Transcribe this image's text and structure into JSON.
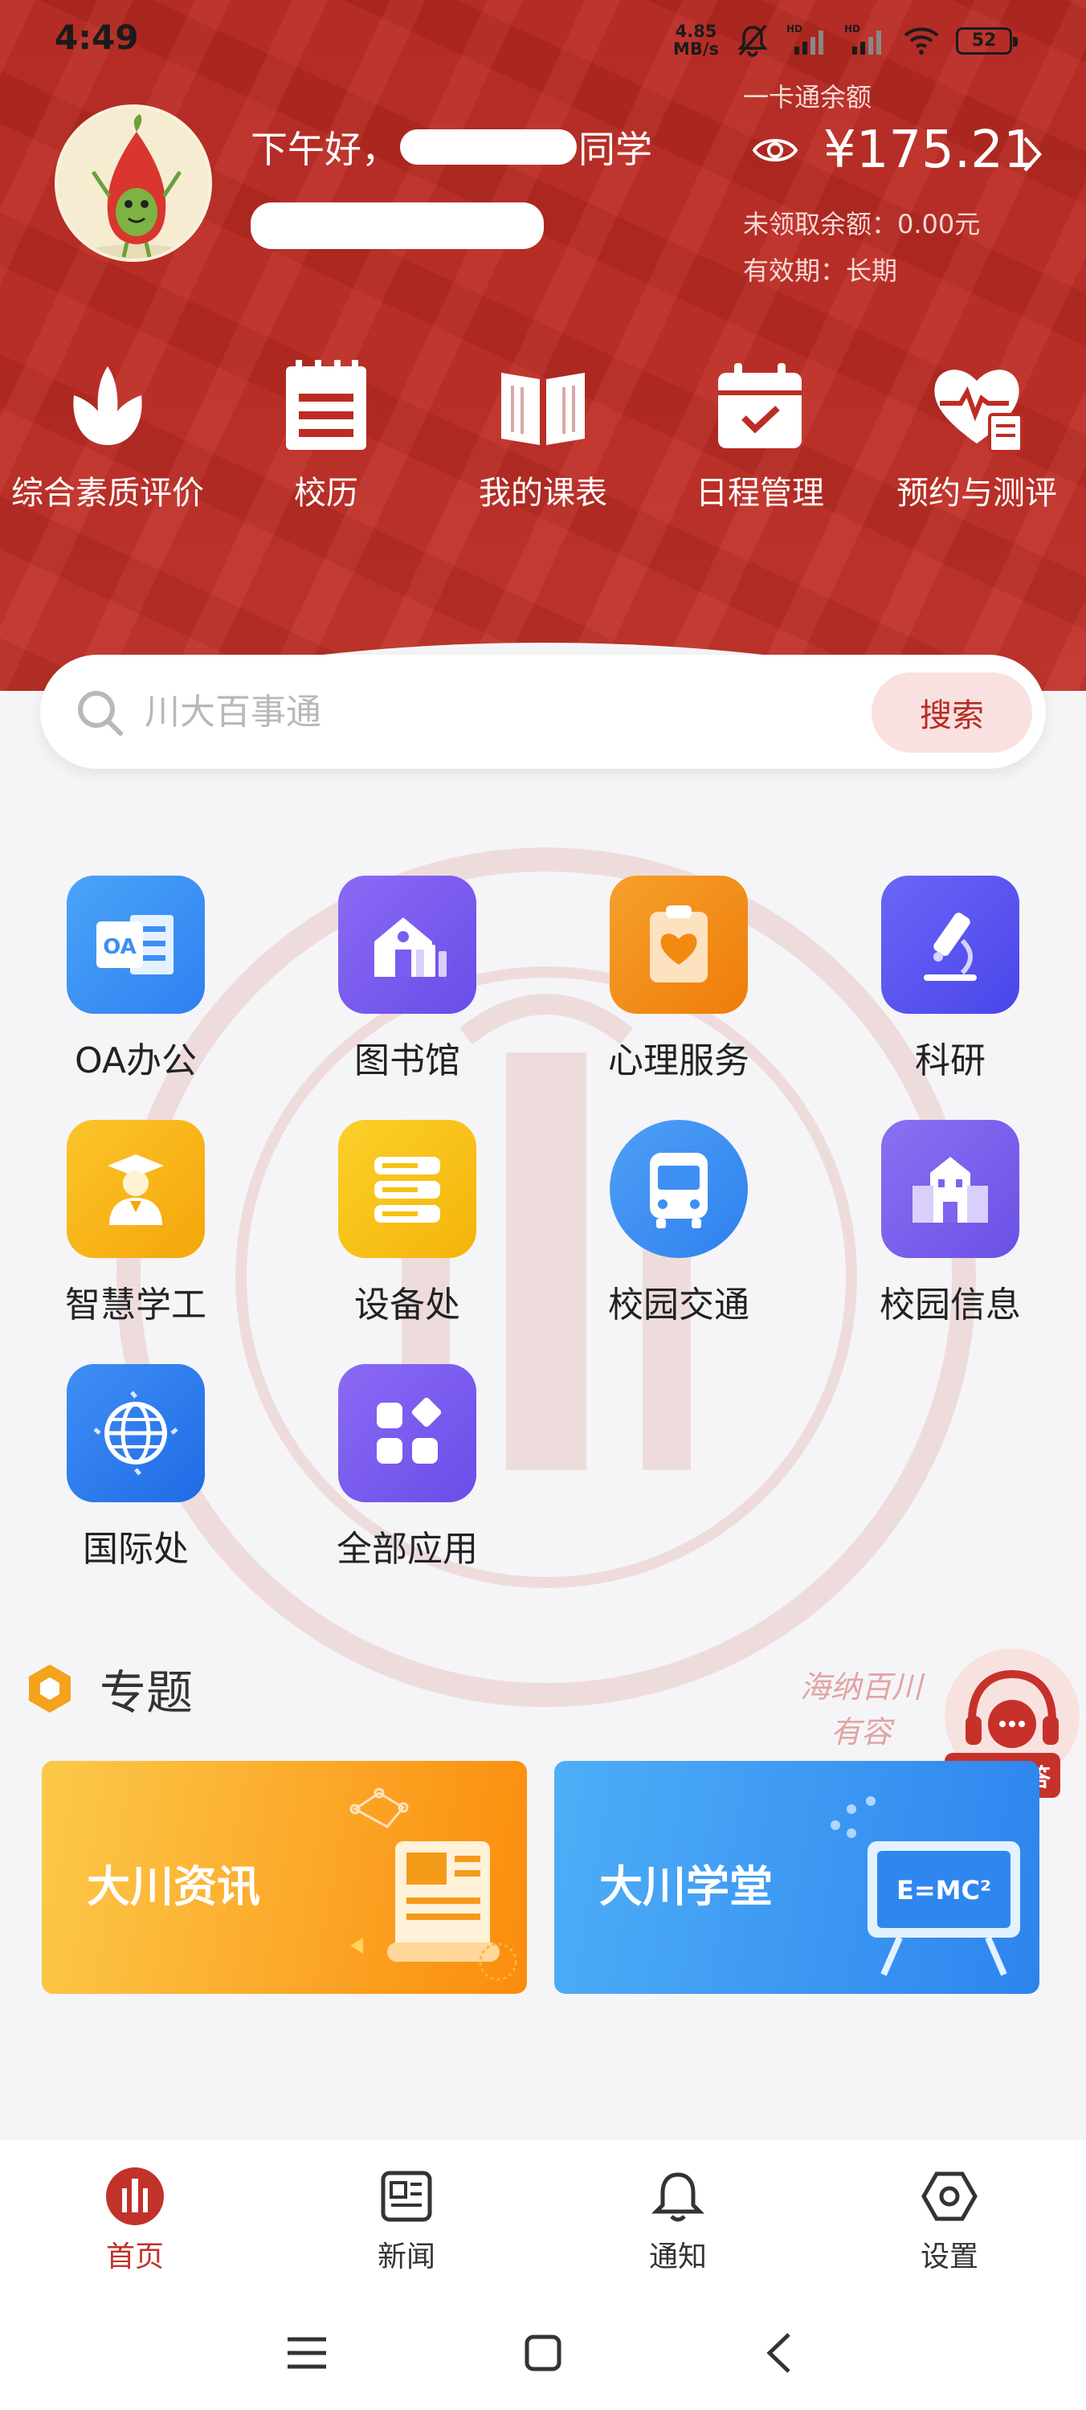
{
  "status_bar": {
    "time": "4:49",
    "net_speed_value": "4.85",
    "net_speed_unit": "MB/s",
    "battery": "52"
  },
  "user": {
    "greeting_prefix": "下午好，",
    "greeting_suffix": "同学"
  },
  "card": {
    "label": "一卡通余额",
    "balance": "¥175.21",
    "unclaimed": "未领取余额：0.00元",
    "validity": "有效期：长期"
  },
  "quick_actions": [
    {
      "label": "综合素质评价",
      "icon": "flower-icon"
    },
    {
      "label": "校历",
      "icon": "calendar-list-icon"
    },
    {
      "label": "我的课表",
      "icon": "open-book-icon"
    },
    {
      "label": "日程管理",
      "icon": "calendar-check-icon"
    },
    {
      "label": "预约与测评",
      "icon": "heart-pulse-icon"
    }
  ],
  "search": {
    "placeholder": "川大百事通",
    "button_label": "搜索"
  },
  "apps": [
    {
      "label": "OA办公",
      "icon": "oa-icon",
      "color": "#3b8ff5"
    },
    {
      "label": "图书馆",
      "icon": "library-icon",
      "color": "#7a5cf0"
    },
    {
      "label": "心理服务",
      "icon": "heart-clipboard-icon",
      "color": "#f28a12"
    },
    {
      "label": "科研",
      "icon": "microscope-icon",
      "color": "#5a55f2"
    },
    {
      "label": "智慧学工",
      "icon": "graduate-icon",
      "color": "#f7b713"
    },
    {
      "label": "设备处",
      "icon": "server-stack-icon",
      "color": "#f6c010"
    },
    {
      "label": "校园交通",
      "icon": "bus-icon",
      "color": "#3e8ff2"
    },
    {
      "label": "校园信息",
      "icon": "campus-building-icon",
      "color": "#7e63ee"
    },
    {
      "label": "国际处",
      "icon": "globe-icon",
      "color": "#2f7bef"
    },
    {
      "label": "全部应用",
      "icon": "all-apps-icon",
      "color": "#7a5cf0"
    }
  ],
  "topics": {
    "title": "专题",
    "calligraphy_line1": "海纳百川",
    "calligraphy_line2": "有容",
    "finance_qa_label": "财务问答",
    "cards": [
      {
        "title": "大川资讯",
        "color_start": "#fbc340",
        "color_end": "#fb8a0c"
      },
      {
        "title": "大川学堂",
        "color_start": "#45a8f7",
        "color_end": "#2f86ef",
        "formula": "E=MC²"
      }
    ]
  },
  "bottom_nav": [
    {
      "label": "首页",
      "icon": "home-logo-icon",
      "active": true
    },
    {
      "label": "新闻",
      "icon": "news-icon",
      "active": false
    },
    {
      "label": "通知",
      "icon": "bell-icon",
      "active": false
    },
    {
      "label": "设置",
      "icon": "settings-hexagon-icon",
      "active": false
    }
  ],
  "colors": {
    "brand_red": "#bd2c24",
    "search_button_bg": "#f8e1e0",
    "active_nav": "#c1322a"
  }
}
